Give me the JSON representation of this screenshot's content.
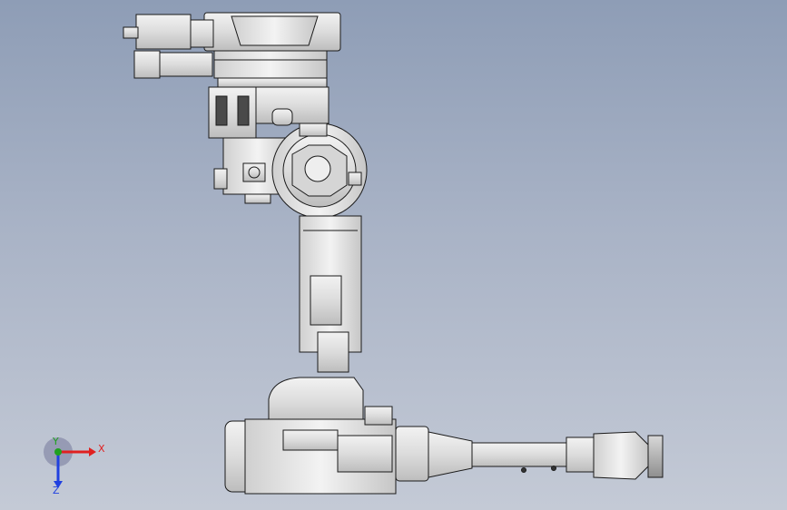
{
  "viewport": {
    "background_top": "#8e9db6",
    "background_bottom": "#c4cad6",
    "model": "six-axis-robot-arm",
    "part_fill": "#e9e9e9",
    "part_edge": "#1a1a1a"
  },
  "triad": {
    "x_label": "X",
    "y_label": "Y",
    "z_label": "Z",
    "x_color": "#e02020",
    "y_color": "#20a020",
    "z_color": "#2040e0"
  }
}
